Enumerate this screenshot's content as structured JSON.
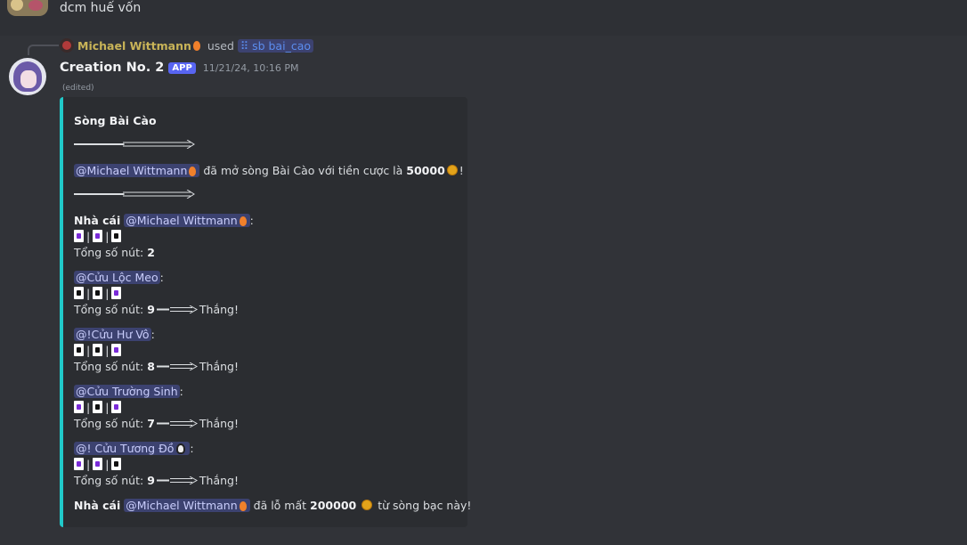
{
  "previous_message": {
    "text": "dcm huế vốn"
  },
  "reply": {
    "user": "Michael Wittmann",
    "used": "used",
    "command": "sb bai_cao",
    "command_icon": "slash-command-icon"
  },
  "message": {
    "bot_name": "Creation No. 2",
    "app_tag": "APP",
    "timestamp": "11/21/24, 10:16 PM",
    "edited": "(edited)"
  },
  "embed": {
    "accent_color": "#21c9c9",
    "title": "Sòng Bài Cào",
    "open_mention": "@Michael Wittmann",
    "open_text": "đã mở sòng Bài Cào với tiền cược là",
    "bet": "50000",
    "bang": "!",
    "dealer_label": "Nhà cái",
    "dealer_mention": "@Michael Wittmann",
    "colon": ":",
    "total_label": "Tổng số nút:",
    "dealer_total": "2",
    "win_text": "Thắng!",
    "players": [
      {
        "mention": "@Cửu Lộc Meo",
        "total": "9"
      },
      {
        "mention": "@!Cửu Hư Vô",
        "total": "8"
      },
      {
        "mention": "@Cửu Trường Sinh",
        "total": "7"
      },
      {
        "mention": "@! Cửu Tương Đồ",
        "total": "9"
      }
    ],
    "result_label": "Nhà cái",
    "result_mention": "@Michael Wittmann",
    "result_text": "đã lỗ mất",
    "loss": "200000",
    "result_tail": "từ sòng bạc này!"
  }
}
